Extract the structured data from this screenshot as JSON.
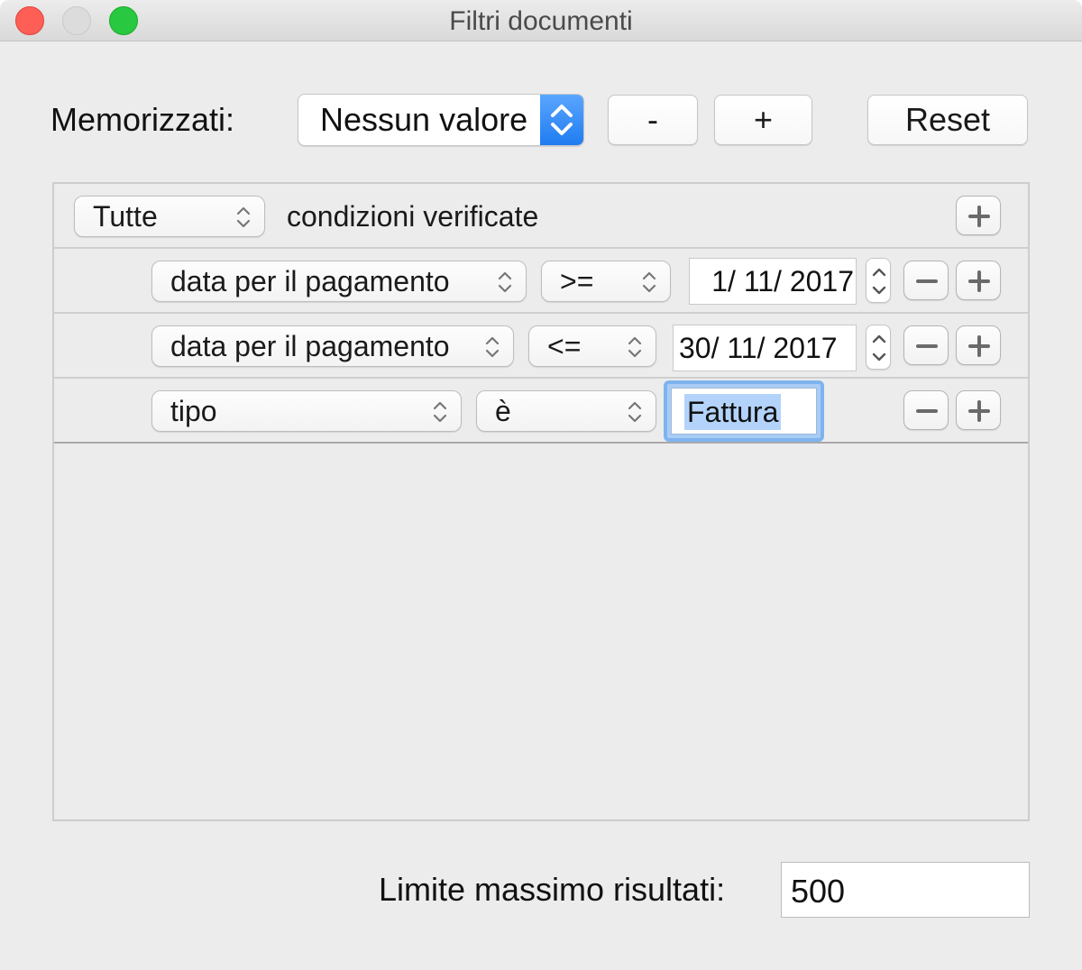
{
  "window": {
    "title": "Filtri documenti"
  },
  "header": {
    "saved_label": "Memorizzati:",
    "saved_value": "Nessun valore",
    "remove_label": "-",
    "add_label": "+",
    "reset_label": "Reset"
  },
  "conditions": {
    "match_mode": "Tutte",
    "match_suffix": "condizioni verificate",
    "rows": [
      {
        "field": "data per il pagamento",
        "operator": ">=",
        "value": "1/ 11/ 2017"
      },
      {
        "field": "data per il pagamento",
        "operator": "<=",
        "value": "30/ 11/ 2017"
      },
      {
        "field": "tipo",
        "operator": "è",
        "value": "Fattura"
      }
    ]
  },
  "footer": {
    "limit_label": "Limite massimo risultati:",
    "limit_value": "500"
  },
  "colors": {
    "accent": "#2f86f6",
    "focus_ring": "#7fb3f0",
    "selection": "#b3d3fb",
    "window_bg": "#ececec"
  },
  "icons": [
    "close-icon",
    "minimize-icon",
    "zoom-icon",
    "updown-arrows-icon",
    "plus-icon",
    "minus-icon"
  ]
}
